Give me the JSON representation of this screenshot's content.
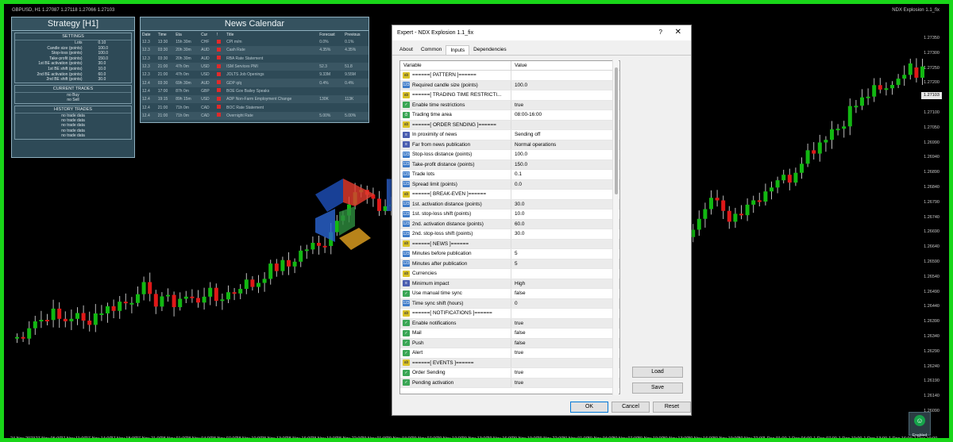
{
  "chart_header": {
    "symbol_line": "GBPUSD, H1  1.27087 1.27118 1.27066 1.27103",
    "ea_label": "NDX Explosion 1.1_fix"
  },
  "strategy_panel": {
    "title": "Strategy [H1]",
    "settings_title": "SETTINGS",
    "settings": [
      {
        "k": "Lots",
        "v": "0.10"
      },
      {
        "k": "Candle size (points)",
        "v": "100.0"
      },
      {
        "k": "Stop-loss (points)",
        "v": "100.0"
      },
      {
        "k": "Take-profit (points)",
        "v": "150.0"
      },
      {
        "k": "1st BE activation (points)",
        "v": "30.0"
      },
      {
        "k": "1st BE shift (points)",
        "v": "10.0"
      },
      {
        "k": "2nd BE activation (points)",
        "v": "60.0"
      },
      {
        "k": "2nd BE shift (points)",
        "v": "30.0"
      }
    ],
    "current_trades_title": "CURRENT TRADES",
    "current_trades": [
      "no Buy",
      "no Sell"
    ],
    "history_title": "HISTORY TRADES",
    "history": [
      "no trade data",
      "no trade data",
      "no trade data",
      "no trade data",
      "no trade data"
    ]
  },
  "news_panel": {
    "title": "News Calendar",
    "columns": [
      "Date",
      "Time",
      "Eta",
      "Cur",
      "!",
      "Title",
      "Forecast",
      "Previous"
    ],
    "rows": [
      [
        "12.3",
        "13:30",
        "15h 30m",
        "CHF",
        "",
        "CPI m/m",
        "0.0%",
        "0.1%"
      ],
      [
        "12.3",
        "03:30",
        "20h 30m",
        "AUD",
        "",
        "Cash Rate",
        "4.35%",
        "4.35%"
      ],
      [
        "12.3",
        "03:30",
        "20h 30m",
        "AUD",
        "",
        "RBA Rate Statement",
        "",
        ""
      ],
      [
        "12.3",
        "21:00",
        "47h 0m",
        "USD",
        "",
        "ISM Services PMI",
        "52.3",
        "51.8"
      ],
      [
        "12.3",
        "21:00",
        "47h 0m",
        "USD",
        "",
        "JOLTS Job Openings",
        "9.33M",
        "9.55M"
      ],
      [
        "12.4",
        "03:30",
        "69h 30m",
        "AUD",
        "",
        "GDP q/q",
        "0.4%",
        "0.4%"
      ],
      [
        "12.4",
        "17:00",
        "87h 0m",
        "GBP",
        "",
        "BOE Gov Bailey Speaks",
        "",
        ""
      ],
      [
        "12.4",
        "19:15",
        "89h 15m",
        "USD",
        "",
        "ADP Non-Farm Employment Change",
        "130K",
        "113K"
      ],
      [
        "12.4",
        "21:00",
        "71h 0m",
        "CAD",
        "",
        "BOC Rate Statement",
        "",
        ""
      ],
      [
        "12.4",
        "21:00",
        "71h 0m",
        "CAD",
        "",
        "Overnight Rate",
        "5.00%",
        "5.00%"
      ]
    ]
  },
  "watermark": {
    "brand": "EaForex",
    "store": "store.com"
  },
  "dialog": {
    "title": "Expert - NDX Explosion 1.1_fix",
    "help": "?",
    "close": "✕",
    "tabs": [
      "About",
      "Common",
      "Inputs",
      "Dependencies"
    ],
    "active_tab": "Inputs",
    "col_variable": "Variable",
    "col_value": "Value",
    "params": [
      {
        "t": "ab",
        "name": "======[ PATTERN ]======",
        "value": ""
      },
      {
        "t": "num",
        "name": "Required candle size (points)",
        "value": "100.0"
      },
      {
        "t": "ab",
        "name": "======[ TRADING TIME RESTRICTI...",
        "value": ""
      },
      {
        "t": "bool",
        "name": "Enable time restrictions",
        "value": "true"
      },
      {
        "t": "time",
        "name": "Trading time area",
        "value": "08:00-16:00"
      },
      {
        "t": "ab",
        "name": "======[ ORDER SENDING ]======",
        "value": ""
      },
      {
        "t": "en",
        "name": "In proximity of news",
        "value": "Sending off"
      },
      {
        "t": "en",
        "name": "Far from news publication",
        "value": "Normal operations"
      },
      {
        "t": "num",
        "name": "Stop-loss distance (points)",
        "value": "100.0"
      },
      {
        "t": "num",
        "name": "Take-profit distance (points)",
        "value": "150.0"
      },
      {
        "t": "num",
        "name": "Trade lots",
        "value": "0.1"
      },
      {
        "t": "num",
        "name": "Spread limit (points)",
        "value": "0.0"
      },
      {
        "t": "ab",
        "name": "======[ BREAK-EVEN ]======",
        "value": ""
      },
      {
        "t": "num",
        "name": "1st. activation distance (points)",
        "value": "30.0"
      },
      {
        "t": "num",
        "name": "1st. stop-loss shift (points)",
        "value": "10.0"
      },
      {
        "t": "num",
        "name": "2nd. activation distance (points)",
        "value": "60.0"
      },
      {
        "t": "num",
        "name": "2nd. stop-loss shift (points)",
        "value": "30.0"
      },
      {
        "t": "ab",
        "name": "======[ NEWS ]======",
        "value": ""
      },
      {
        "t": "num",
        "name": "Minutes before publication",
        "value": "5"
      },
      {
        "t": "num",
        "name": "Minutes after publication",
        "value": "5"
      },
      {
        "t": "ab",
        "name": "Currencies",
        "value": ""
      },
      {
        "t": "en",
        "name": "Minimum impact",
        "value": "High"
      },
      {
        "t": "bool",
        "name": "Use manual time sync",
        "value": "false"
      },
      {
        "t": "num",
        "name": "Time sync shift (hours)",
        "value": "0"
      },
      {
        "t": "ab",
        "name": "======[ NOTIFICATIONS ]======",
        "value": ""
      },
      {
        "t": "bool",
        "name": "Enable notifications",
        "value": "true"
      },
      {
        "t": "bool",
        "name": "Mail",
        "value": "false"
      },
      {
        "t": "bool",
        "name": "Push",
        "value": "false"
      },
      {
        "t": "bool",
        "name": "Alert",
        "value": "true"
      },
      {
        "t": "ab",
        "name": "======[ EVENTS ]======",
        "value": ""
      },
      {
        "t": "bool",
        "name": "Order Sending",
        "value": "true"
      },
      {
        "t": "bool",
        "name": "Pending activation",
        "value": "true"
      }
    ],
    "buttons": {
      "load": "Load",
      "save": "Save",
      "ok": "OK",
      "cancel": "Cancel",
      "reset": "Reset"
    }
  },
  "enabled_badge": {
    "label": "Enabled"
  },
  "price_axis": {
    "labels": [
      "1.27350",
      "1.27300",
      "1.27250",
      "1.27200",
      "1.27150",
      "1.27100",
      "1.27050",
      "1.26990",
      "1.26940",
      "1.26890",
      "1.26840",
      "1.26790",
      "1.26740",
      "1.26690",
      "1.26640",
      "1.26590",
      "1.26540",
      "1.26490",
      "1.26440",
      "1.26390",
      "1.26340",
      "1.26290",
      "1.26240",
      "1.26190",
      "1.26140",
      "1.26090"
    ],
    "current_price": "1.27103"
  },
  "time_axis": {
    "labels": [
      "24 Nov 2023",
      "27 Nov 05:00",
      "27 Nov 11:00",
      "27 Nov 14:00",
      "27 Nov 18:00",
      "27 Nov 21:00",
      "28 Nov 01:00",
      "28 Nov 04:00",
      "28 Nov 07:00",
      "28 Nov 10:00",
      "28 Nov 13:00",
      "28 Nov 16:00",
      "28 Nov 19:00",
      "28 Nov 22:00",
      "29 Nov 01:00",
      "29 Nov 04:00",
      "29 Nov 07:00",
      "29 Nov 10:00",
      "29 Nov 13:00",
      "29 Nov 16:00",
      "29 Nov 19:00",
      "29 Nov 22:00",
      "30 Nov 01:00",
      "30 Nov 04:00",
      "30 Nov 07:00",
      "30 Nov 10:00",
      "30 Nov 13:00",
      "30 Nov 16:00",
      "30 Nov 19:00",
      "30 Nov 22:00",
      "1 Dec 01:00",
      "1 Dec 04:00",
      "1 Dec 07:00",
      "1 Dec 10:00",
      "1 Dec 13:00",
      "1 Dec 16:00",
      "1 Dec 19:00"
    ]
  },
  "colors": {
    "frame": "#19d619",
    "bull": "#12b812",
    "bear": "#e01818",
    "panel": "#2e4a57"
  }
}
